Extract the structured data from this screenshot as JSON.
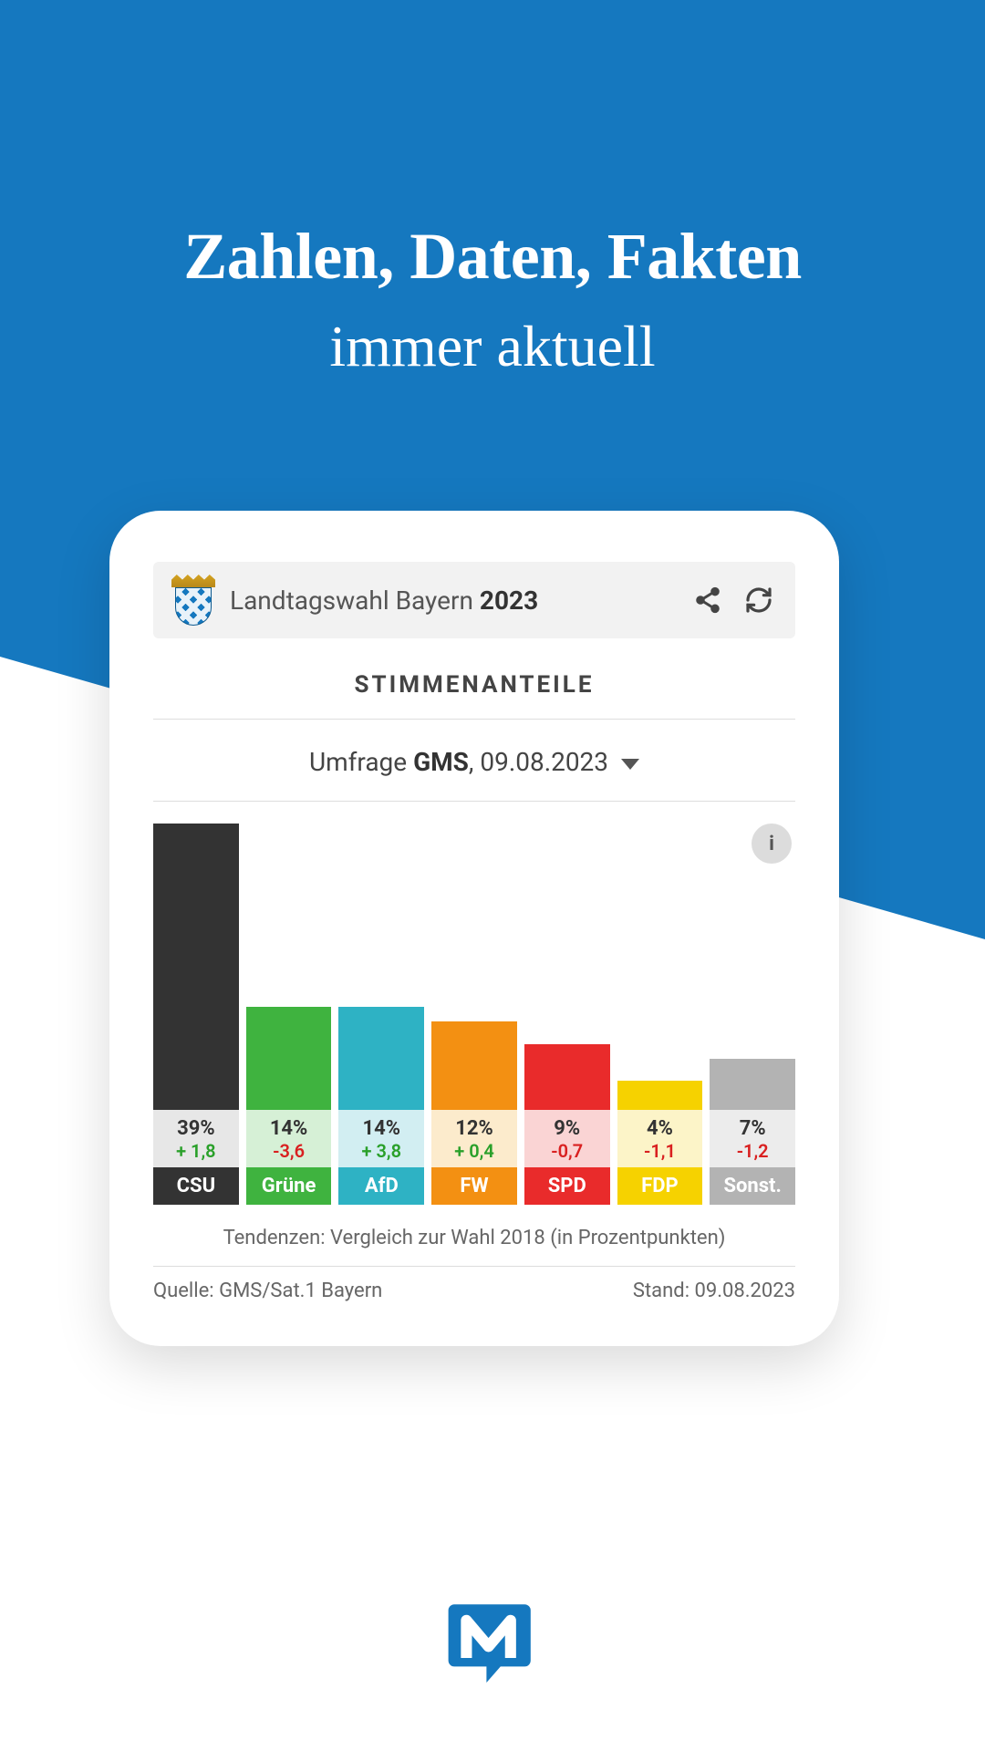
{
  "headline": {
    "bold": "Zahlen, Daten, Fakten",
    "light": "immer aktuell"
  },
  "card": {
    "title_prefix": "Landtagswahl Bayern ",
    "title_year": "2023",
    "section_title": "STIMMENANTEILE",
    "subtitle_prefix": "Umfrage ",
    "subtitle_source": "GMS",
    "subtitle_date": ", 09.08.2023",
    "footnote": "Tendenzen: Vergleich zur Wahl 2018 (in Prozentpunkten)",
    "footer_left": "Quelle: GMS/Sat.1 Bayern",
    "footer_right": "Stand: 09.08.2023"
  },
  "chart_data": {
    "type": "bar",
    "title": "STIMMENANTEILE",
    "xlabel": "",
    "ylabel": "",
    "ylim": [
      0,
      40
    ],
    "categories": [
      "CSU",
      "Grüne",
      "AfD",
      "FW",
      "SPD",
      "FDP",
      "Sonst."
    ],
    "values": [
      39,
      14,
      14,
      12,
      9,
      4,
      7
    ],
    "trends": [
      1.8,
      -3.6,
      3.8,
      0.4,
      -0.7,
      -1.1,
      -1.2
    ],
    "colors": [
      "#333333",
      "#3fb33f",
      "#2eb2c4",
      "#f39012",
      "#e92b2b",
      "#f6d200",
      "#b3b3b3"
    ],
    "tint_colors": [
      "#e7e7e7",
      "#d6f0d6",
      "#d2eef2",
      "#fcebcc",
      "#fad4d4",
      "#fcf4c8",
      "#ececec"
    ],
    "value_labels": [
      "39%",
      "14%",
      "14%",
      "12%",
      "9%",
      "4%",
      "7%"
    ],
    "trend_labels": [
      "+ 1,8",
      "-3,6",
      "+ 3,8",
      "+ 0,4",
      "-0,7",
      "-1,1",
      "-1,2"
    ]
  },
  "icons": {
    "share": "share-icon",
    "refresh": "refresh-icon",
    "info": "i"
  },
  "colors": {
    "brand_blue": "#1578bf"
  }
}
